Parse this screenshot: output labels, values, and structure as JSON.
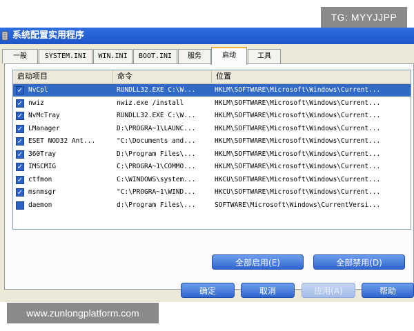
{
  "watermark_top": "TG: MYYJJPP",
  "watermark_bottom": "www.zunlongplatform.com",
  "window": {
    "title": "系统配置实用程序"
  },
  "tabs": [
    {
      "label": "一般",
      "active": false
    },
    {
      "label": "SYSTEM.INI",
      "active": false
    },
    {
      "label": "WIN.INI",
      "active": false
    },
    {
      "label": "BOOT.INI",
      "active": false
    },
    {
      "label": "服务",
      "active": false
    },
    {
      "label": "启动",
      "active": true
    },
    {
      "label": "工具",
      "active": false
    }
  ],
  "list": {
    "columns": [
      "启动项目",
      "命令",
      "位置"
    ],
    "rows": [
      {
        "checked": true,
        "selected": true,
        "name": "NvCpl",
        "command": "RUNDLL32.EXE C:\\W...",
        "location": "HKLM\\SOFTWARE\\Microsoft\\Windows\\Current..."
      },
      {
        "checked": true,
        "selected": false,
        "name": "nwiz",
        "command": "nwiz.exe /install",
        "location": "HKLM\\SOFTWARE\\Microsoft\\Windows\\Current..."
      },
      {
        "checked": true,
        "selected": false,
        "name": "NvMcTray",
        "command": "RUNDLL32.EXE C:\\W...",
        "location": "HKLM\\SOFTWARE\\Microsoft\\Windows\\Current..."
      },
      {
        "checked": true,
        "selected": false,
        "name": "LManager",
        "command": "D:\\PROGRA~1\\LAUNC...",
        "location": "HKLM\\SOFTWARE\\Microsoft\\Windows\\Current..."
      },
      {
        "checked": true,
        "selected": false,
        "name": "ESET NOD32 Ant...",
        "command": "\"C:\\Documents and...",
        "location": "HKLM\\SOFTWARE\\Microsoft\\Windows\\Current..."
      },
      {
        "checked": true,
        "selected": false,
        "name": "360Tray",
        "command": "D:\\Program Files\\...",
        "location": "HKLM\\SOFTWARE\\Microsoft\\Windows\\Current..."
      },
      {
        "checked": true,
        "selected": false,
        "name": "IMSCMIG",
        "command": "C:\\PROGRA~1\\COMMO...",
        "location": "HKLM\\SOFTWARE\\Microsoft\\Windows\\Current..."
      },
      {
        "checked": true,
        "selected": false,
        "name": "ctfmon",
        "command": "C:\\WINDOWS\\system...",
        "location": "HKCU\\SOFTWARE\\Microsoft\\Windows\\Current..."
      },
      {
        "checked": true,
        "selected": false,
        "name": "msnmsgr",
        "command": "\"C:\\PROGRA~1\\WIND...",
        "location": "HKCU\\SOFTWARE\\Microsoft\\Windows\\Current..."
      },
      {
        "checked": false,
        "selected": false,
        "name": "daemon",
        "command": "d:\\Program Files\\...",
        "location": "SOFTWARE\\Microsoft\\Windows\\CurrentVersi..."
      }
    ]
  },
  "buttons": {
    "enable_all": "全部启用(E)",
    "disable_all": "全部禁用(D)",
    "ok": "确定",
    "cancel": "取消",
    "apply": "应用(A)",
    "help": "帮助"
  },
  "colors": {
    "titlebar": "#2f6fe0",
    "selection": "#316ac5",
    "tab_highlight": "#f1b43b",
    "button": "#2f66cf"
  }
}
